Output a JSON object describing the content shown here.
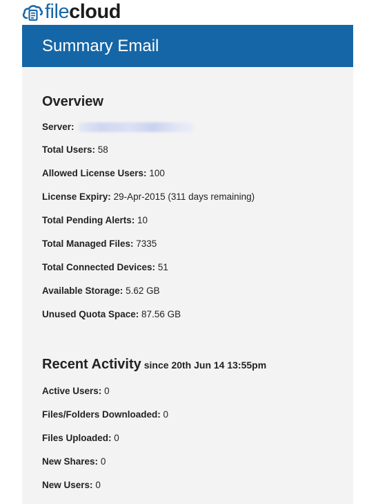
{
  "logo": {
    "part1": "file",
    "part2": "cloud",
    "accent": "#1a67a8",
    "icon": "cloud-document-icon"
  },
  "banner": {
    "title": "Summary Email",
    "color": "#1566a6"
  },
  "overview": {
    "heading": "Overview",
    "server_label": "Server:",
    "server_value_redacted": true,
    "rows": [
      {
        "label": "Total Users:",
        "value": "58"
      },
      {
        "label": "Allowed License Users:",
        "value": "100"
      },
      {
        "label": "License Expiry:",
        "value": "29-Apr-2015 (311 days remaining)"
      },
      {
        "label": "Total Pending Alerts:",
        "value": "10"
      },
      {
        "label": "Total Managed Files:",
        "value": "7335"
      },
      {
        "label": "Total Connected Devices:",
        "value": "51"
      },
      {
        "label": "Available Storage:",
        "value": "5.62 GB"
      },
      {
        "label": "Unused Quota Space:",
        "value": "87.56 GB"
      }
    ]
  },
  "activity": {
    "heading": "Recent Activity",
    "since": "since 20th Jun 14 13:55pm",
    "rows": [
      {
        "label": "Active Users:",
        "value": "0"
      },
      {
        "label": "Files/Folders Downloaded:",
        "value": "0"
      },
      {
        "label": "Files Uploaded:",
        "value": "0"
      },
      {
        "label": "New Shares:",
        "value": "0"
      },
      {
        "label": "New Users:",
        "value": "0"
      }
    ]
  }
}
